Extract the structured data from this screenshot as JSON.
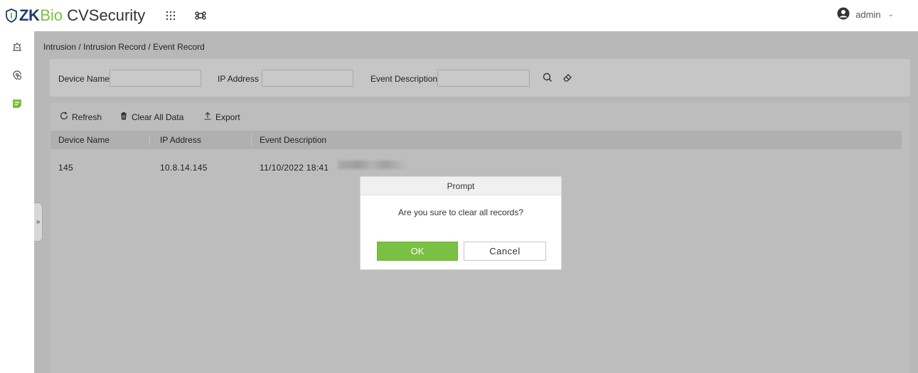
{
  "app": {
    "logo_zk": "ZK",
    "logo_bio": "Bio",
    "logo_rest": " CVSecurity",
    "user": "admin"
  },
  "breadcrumb": "Intrusion / Intrusion Record / Event Record",
  "filters": {
    "device_name_label": "Device Name",
    "ip_address_label": "IP Address",
    "event_description_label": "Event Description",
    "device_name_value": "",
    "ip_address_value": "",
    "event_description_value": ""
  },
  "toolbar": {
    "refresh": "Refresh",
    "clear_all": "Clear All Data",
    "export": "Export"
  },
  "table": {
    "columns": [
      "Device Name",
      "IP Address",
      "Event Description"
    ],
    "rows": [
      {
        "device_name": "145",
        "ip_address": "10.8.14.145",
        "event_description": "11/10/2022 18:41"
      }
    ]
  },
  "collapse_label": "»",
  "dialog": {
    "title": "Prompt",
    "message": "Are you sure to clear all records?",
    "ok": "OK",
    "cancel": "Cancel"
  },
  "colors": {
    "brand_green": "#7ac143",
    "brand_navy": "#1d3c6e"
  },
  "icons": {
    "logo": "shield-icon",
    "apps": "grid-icon",
    "shortcut": "command-icon",
    "user": "user-circle-icon",
    "rail": [
      "intrusion-alarm-icon",
      "zone-icon",
      "record-icon"
    ],
    "search": "search-icon",
    "clear": "eraser-icon",
    "refresh": "refresh-icon",
    "delete": "trash-icon",
    "export": "export-icon"
  }
}
